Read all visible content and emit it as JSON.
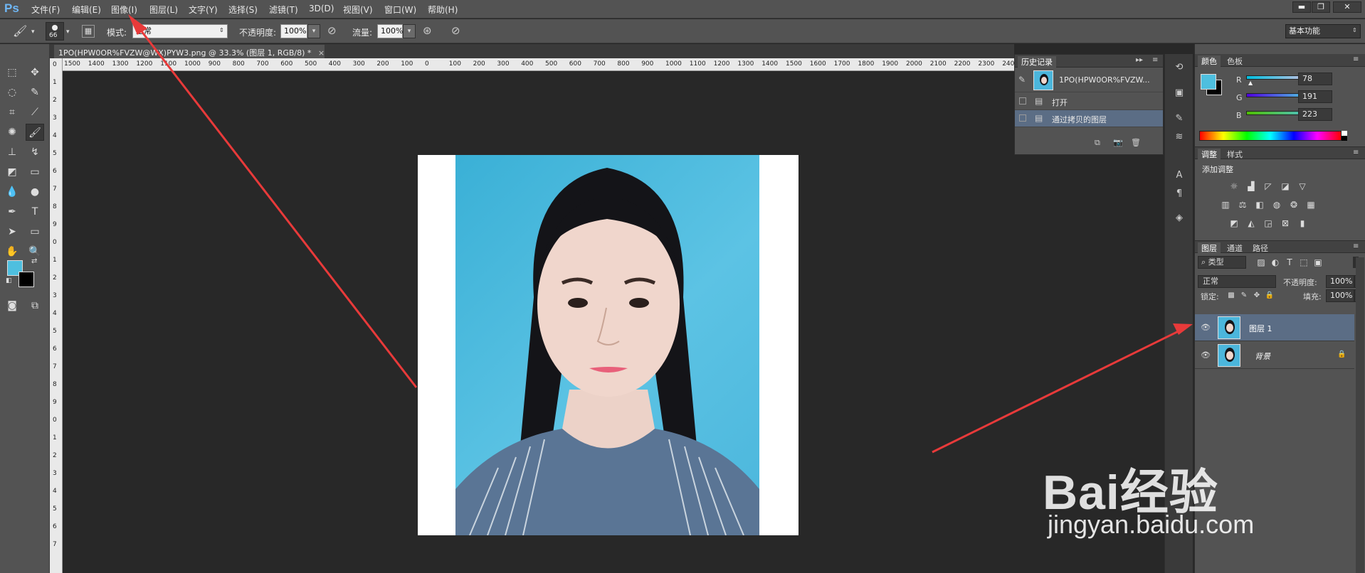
{
  "app": {
    "logo": "Ps"
  },
  "menu": [
    "文件(F)",
    "编辑(E)",
    "图像(I)",
    "图层(L)",
    "文字(Y)",
    "选择(S)",
    "滤镜(T)",
    "3D(D)",
    "视图(V)",
    "窗口(W)",
    "帮助(H)"
  ],
  "window_controls": {
    "minimize": "▬",
    "restore": "❐",
    "close": "✕"
  },
  "options": {
    "brush_size": "66",
    "mode_label": "模式:",
    "mode_value": "正常",
    "opacity_label": "不透明度:",
    "opacity_value": "100%",
    "flow_label": "流量:",
    "flow_value": "100%",
    "workspace": "基本功能"
  },
  "document": {
    "tab_title": "1PO(HPW0OR%FVZW@WX)PYW3.png @ 33.3% (图层 1, RGB/8) *",
    "close": "×"
  },
  "ruler": {
    "h_ticks": [
      "1500",
      "1400",
      "1300",
      "1200",
      "1100",
      "1000",
      "900",
      "800",
      "700",
      "600",
      "500",
      "400",
      "300",
      "200",
      "100",
      "0",
      "100",
      "200",
      "300",
      "400",
      "500",
      "600",
      "700",
      "800",
      "900",
      "1000",
      "1100",
      "1200",
      "1300",
      "1400",
      "1500",
      "1600",
      "1700",
      "1800",
      "1900",
      "2000",
      "2100",
      "2200",
      "2300",
      "2400"
    ],
    "v_ticks": [
      "0",
      "1",
      "2",
      "3",
      "4",
      "5",
      "6",
      "7",
      "8",
      "9",
      "0",
      "1",
      "2",
      "3",
      "4",
      "5",
      "6",
      "7",
      "8",
      "9",
      "0",
      "1",
      "2",
      "3",
      "4",
      "5",
      "6",
      "7"
    ]
  },
  "history": {
    "tab": "历史记录",
    "snapshot": "1PO(HPW0OR%FVZW...",
    "items": [
      "打开",
      "通过拷贝的图层"
    ]
  },
  "color": {
    "tabs": [
      "颜色",
      "色板"
    ],
    "r_label": "R",
    "r": "78",
    "g_label": "G",
    "g": "191",
    "b_label": "B",
    "b": "223",
    "fg": "#4ebfdf",
    "bg": "#000000"
  },
  "adjustments": {
    "tabs": [
      "调整",
      "样式"
    ],
    "title": "添加调整"
  },
  "layers": {
    "tabs": [
      "图层",
      "通道",
      "路径"
    ],
    "filter_kind": "类型",
    "blend": "正常",
    "opacity_label": "不透明度:",
    "opacity": "100%",
    "lock_label": "锁定:",
    "fill_label": "填充:",
    "fill": "100%",
    "items": [
      "图层 1",
      "背景"
    ]
  },
  "watermark": {
    "text": "Bai经验",
    "url": "jingyan.baidu.com"
  }
}
